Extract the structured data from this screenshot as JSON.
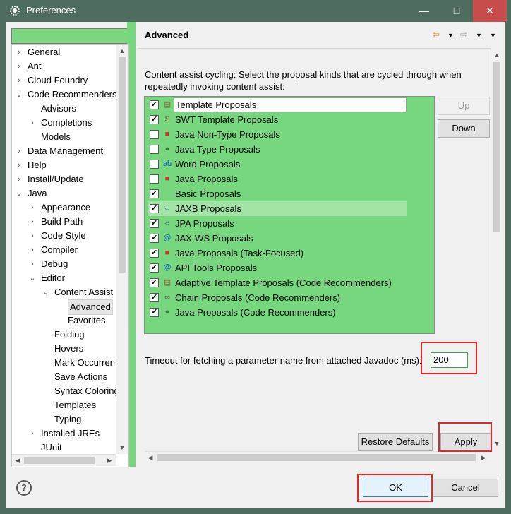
{
  "window": {
    "title": "Preferences",
    "minimize": "—",
    "maximize": "□",
    "close": "✕"
  },
  "filter": {
    "value": ""
  },
  "tree": [
    {
      "label": "General",
      "twisty": "›",
      "level": 0
    },
    {
      "label": "Ant",
      "twisty": "›",
      "level": 0
    },
    {
      "label": "Cloud Foundry",
      "twisty": "›",
      "level": 0
    },
    {
      "label": "Code Recommenders",
      "twisty": "⌄",
      "level": 0
    },
    {
      "label": "Advisors",
      "twisty": "",
      "level": 1
    },
    {
      "label": "Completions",
      "twisty": "›",
      "level": 1
    },
    {
      "label": "Models",
      "twisty": "",
      "level": 1
    },
    {
      "label": "Data Management",
      "twisty": "›",
      "level": 0
    },
    {
      "label": "Help",
      "twisty": "›",
      "level": 0
    },
    {
      "label": "Install/Update",
      "twisty": "›",
      "level": 0
    },
    {
      "label": "Java",
      "twisty": "⌄",
      "level": 0
    },
    {
      "label": "Appearance",
      "twisty": "›",
      "level": 1
    },
    {
      "label": "Build Path",
      "twisty": "›",
      "level": 1
    },
    {
      "label": "Code Style",
      "twisty": "›",
      "level": 1
    },
    {
      "label": "Compiler",
      "twisty": "›",
      "level": 1
    },
    {
      "label": "Debug",
      "twisty": "›",
      "level": 1
    },
    {
      "label": "Editor",
      "twisty": "⌄",
      "level": 1
    },
    {
      "label": "Content Assist",
      "twisty": "⌄",
      "level": 2
    },
    {
      "label": "Advanced",
      "twisty": "",
      "level": 3,
      "selected": true
    },
    {
      "label": "Favorites",
      "twisty": "",
      "level": 3
    },
    {
      "label": "Folding",
      "twisty": "",
      "level": 2
    },
    {
      "label": "Hovers",
      "twisty": "",
      "level": 2
    },
    {
      "label": "Mark Occurren",
      "twisty": "",
      "level": 2
    },
    {
      "label": "Save Actions",
      "twisty": "",
      "level": 2
    },
    {
      "label": "Syntax Coloring",
      "twisty": "",
      "level": 2
    },
    {
      "label": "Templates",
      "twisty": "",
      "level": 2
    },
    {
      "label": "Typing",
      "twisty": "",
      "level": 2
    },
    {
      "label": "Installed JREs",
      "twisty": "›",
      "level": 1
    },
    {
      "label": "JUnit",
      "twisty": "",
      "level": 1
    }
  ],
  "page": {
    "title": "Advanced",
    "description": "Content assist cycling: Select the proposal kinds that are cycled through when repeatedly invoking content assist:",
    "proposals": [
      {
        "label": "Template Proposals",
        "checked": true,
        "icon": "▤",
        "color": "#7a5b2a"
      },
      {
        "label": "SWT Template Proposals",
        "checked": true,
        "icon": "S",
        "color": "#8a4a2a"
      },
      {
        "label": "Java Non-Type Proposals",
        "checked": false,
        "icon": "■",
        "color": "#c0392b"
      },
      {
        "label": "Java Type Proposals",
        "checked": false,
        "icon": "●",
        "color": "#2e7d32"
      },
      {
        "label": "Word Proposals",
        "checked": false,
        "icon": "ab",
        "color": "#1565c0"
      },
      {
        "label": "Java Proposals",
        "checked": false,
        "icon": "■",
        "color": "#c0392b"
      },
      {
        "label": "Basic Proposals",
        "checked": true,
        "icon": "",
        "color": "#000"
      },
      {
        "label": "JAXB Proposals",
        "checked": true,
        "icon": "⇔",
        "color": "#1565c0"
      },
      {
        "label": "JPA Proposals",
        "checked": true,
        "icon": "⇔",
        "color": "#1565c0"
      },
      {
        "label": "JAX-WS Proposals",
        "checked": true,
        "icon": "@",
        "color": "#1565c0"
      },
      {
        "label": "Java Proposals (Task-Focused)",
        "checked": true,
        "icon": "■",
        "color": "#c0392b"
      },
      {
        "label": "API Tools Proposals",
        "checked": true,
        "icon": "@",
        "color": "#1565c0"
      },
      {
        "label": "Adaptive Template Proposals (Code Recommenders)",
        "checked": true,
        "icon": "▤",
        "color": "#7a5b2a"
      },
      {
        "label": "Chain Proposals (Code Recommenders)",
        "checked": true,
        "icon": "∞",
        "color": "#555"
      },
      {
        "label": "Java Proposals (Code Recommenders)",
        "checked": true,
        "icon": "●",
        "color": "#2e7d32"
      }
    ],
    "up_label": "Up",
    "down_label": "Down",
    "timeout_label": "Timeout for fetching a parameter name from attached Javadoc (ms):",
    "timeout_value": "200",
    "restore_label": "Restore Defaults",
    "apply_label": "Apply"
  },
  "dialog": {
    "ok_label": "OK",
    "cancel_label": "Cancel",
    "help_label": "?"
  }
}
